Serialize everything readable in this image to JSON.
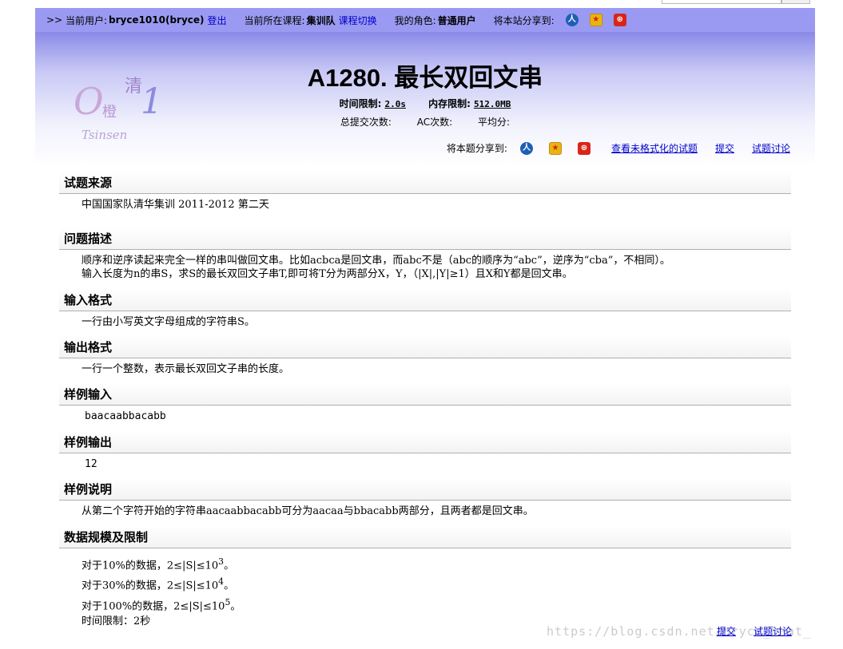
{
  "userbar": {
    "prefix": ">>",
    "current_user_label": "当前用户:",
    "current_user_value": "bryce1010(bryce)",
    "logout": "登出",
    "course_label": "当前所在课程:",
    "course_value": "集训队",
    "course_switch": "课程切换",
    "role_label": "我的角色:",
    "role_value": "普通用户",
    "share_site_label": "将本站分享到:"
  },
  "logo": {
    "big": "O",
    "one": "1",
    "qing": "清",
    "cheng": "橙",
    "tsinsen": "Tsinsen"
  },
  "problem": {
    "title": "A1280. 最长双回文串",
    "time_limit_label": "时间限制:",
    "time_limit_value": "2.0s",
    "memory_limit_label": "内存限制:",
    "memory_limit_value": "512.0MB",
    "total_submit_label": "总提交次数:",
    "ac_label": "AC次数:",
    "avg_label": "平均分:"
  },
  "share_problem": {
    "label": "将本题分享到:",
    "unformatted": "查看未格式化的试题",
    "submit": "提交",
    "discuss": "试题讨论"
  },
  "sections": {
    "source": {
      "title": "试题来源",
      "text": "中国国家队清华集训 2011-2012 第二天"
    },
    "description": {
      "title": "问题描述",
      "line1": "顺序和逆序读起来完全一样的串叫做回文串。比如acbca是回文串，而abc不是（abc的顺序为“abc”，逆序为“cba”，不相同）。",
      "line2": "输入长度为n的串S，求S的最长双回文子串T,即可将T分为两部分X，Y，（|X|,|Y|≥1）且X和Y都是回文串。"
    },
    "input_format": {
      "title": "输入格式",
      "text": "一行由小写英文字母组成的字符串S。"
    },
    "output_format": {
      "title": "输出格式",
      "text": "一行一个整数，表示最长双回文子串的长度。"
    },
    "sample_input": {
      "title": "样例输入",
      "text": "baacaabbacabb"
    },
    "sample_output": {
      "title": "样例输出",
      "text": "12"
    },
    "sample_explain": {
      "title": "样例说明",
      "text": "从第二个字符开始的字符串aacaabbacabb可分为aacaa与bbacabb两部分，且两者都是回文串。"
    },
    "constraints": {
      "title": "数据规模及限制",
      "l1_pre": "对于10%的数据，2≤|S|≤10",
      "l1_exp": "3",
      "l2_pre": "对于30%的数据，2≤|S|≤10",
      "l2_exp": "4",
      "l3_pre": "对于100%的数据，2≤|S|≤10",
      "l3_exp": "5",
      "end": "。",
      "time": "时间限制：2秒"
    }
  },
  "bottom": {
    "submit": "提交",
    "discuss": "试题讨论"
  },
  "watermark": "https://blog.csdn.net/bryce_heat_"
}
